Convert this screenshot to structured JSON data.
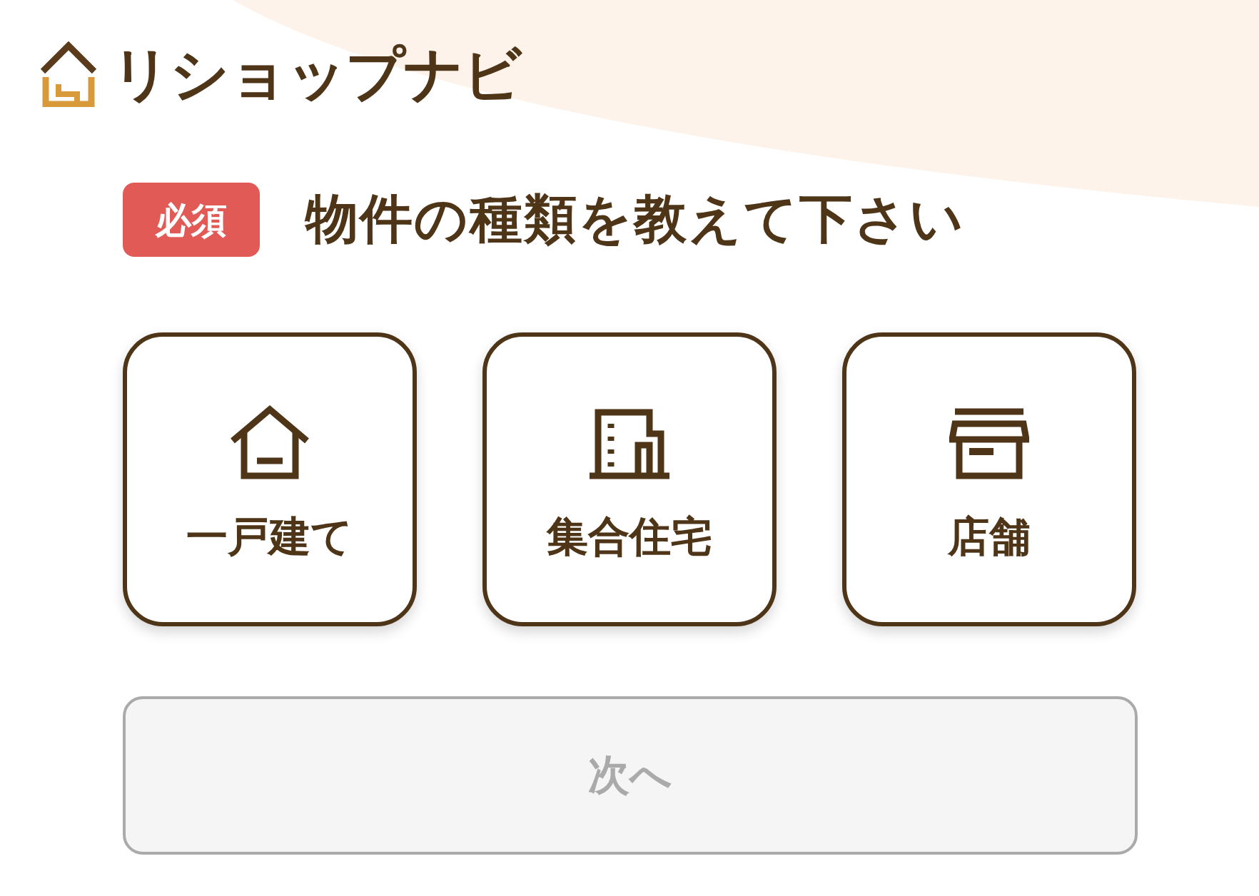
{
  "header": {
    "logo_text": "リショップナビ"
  },
  "question": {
    "required_badge": "必須",
    "text": "物件の種類を教えて下さい"
  },
  "options": [
    {
      "kind": "house",
      "label": "一戸建て",
      "selected": false
    },
    {
      "kind": "apartment",
      "label": "集合住宅",
      "selected": false
    },
    {
      "kind": "store",
      "label": "店舗",
      "selected": false
    }
  ],
  "next_button": {
    "label": "次へ",
    "disabled": true
  }
}
